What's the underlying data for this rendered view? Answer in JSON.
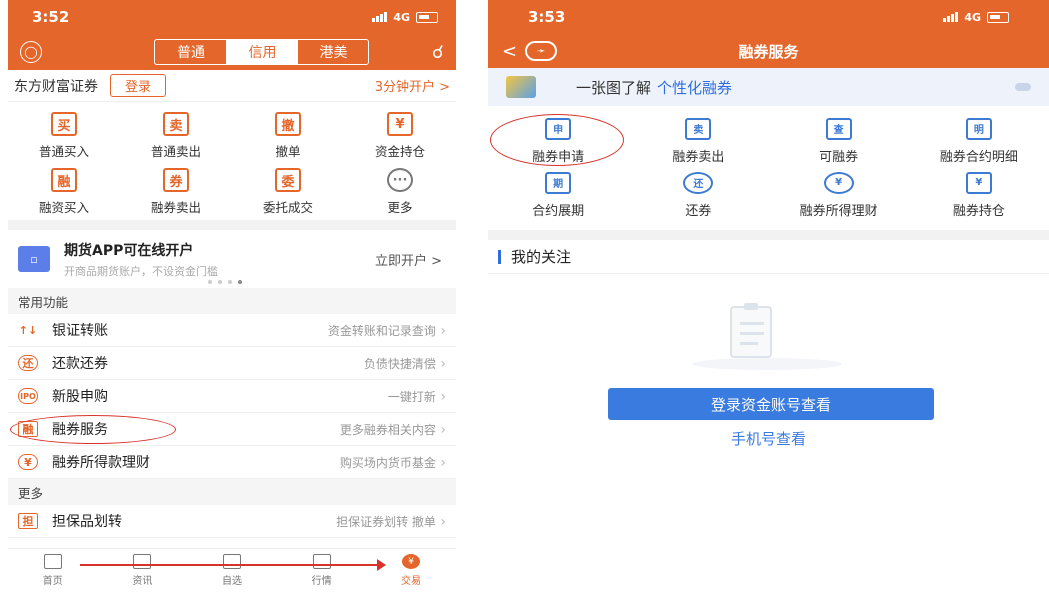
{
  "left": {
    "status": {
      "time": "3:52",
      "network": "4G"
    },
    "nav": {
      "segments": [
        "普通",
        "信用",
        "港美"
      ],
      "active_segment": 1
    },
    "broker": {
      "name": "东方财富证券",
      "login": "登录",
      "open_account": "3分钟开户 >"
    },
    "grid": [
      {
        "icon": "买",
        "label": "普通买入"
      },
      {
        "icon": "卖",
        "label": "普通卖出"
      },
      {
        "icon": "撤",
        "label": "撤单"
      },
      {
        "icon": "¥",
        "label": "资金持仓"
      },
      {
        "icon": "融",
        "label": "融资买入"
      },
      {
        "icon": "券",
        "label": "融券卖出"
      },
      {
        "icon": "委",
        "label": "委托成交"
      },
      {
        "icon": "···",
        "label": "更多"
      }
    ],
    "promo": {
      "title": "期货APP可在线开户",
      "subtitle": "开商品期货账户，不设资金门槛",
      "action": "立即开户 >"
    },
    "section_common": "常用功能",
    "rows_common": [
      {
        "icon": "↑↓",
        "label": "银证转账",
        "sub": "资金转账和记录查询"
      },
      {
        "icon": "还",
        "label": "还款还券",
        "sub": "负债快捷清偿"
      },
      {
        "icon": "IPO",
        "label": "新股申购",
        "sub": "一键打新"
      },
      {
        "icon": "融",
        "label": "融券服务",
        "sub": "更多融券相关内容"
      },
      {
        "icon": "¥",
        "label": "融券所得款理财",
        "sub": "购买场内货币基金"
      }
    ],
    "section_more": "更多",
    "rows_more": [
      {
        "icon": "担",
        "label": "担保品划转",
        "sub": "担保证券划转 撤单"
      }
    ],
    "tabs": [
      {
        "label": "首页"
      },
      {
        "label": "资讯"
      },
      {
        "label": "自选"
      },
      {
        "label": "行情"
      },
      {
        "label": "交易",
        "icon": "¥"
      }
    ]
  },
  "right": {
    "status": {
      "time": "3:53",
      "network": "4G"
    },
    "title": "融券服务",
    "banner": {
      "prefix": "一张图了解",
      "highlight": "个性化融券"
    },
    "grid": [
      {
        "icon": "申",
        "label": "融券申请"
      },
      {
        "icon": "卖",
        "label": "融券卖出"
      },
      {
        "icon": "查",
        "label": "可融券"
      },
      {
        "icon": "明",
        "label": "融券合约明细"
      },
      {
        "icon": "期",
        "label": "合约展期"
      },
      {
        "icon": "还",
        "label": "还券"
      },
      {
        "icon": "¥",
        "label": "融券所得理财"
      },
      {
        "icon": "¥",
        "label": "融券持仓"
      }
    ],
    "follow_title": "我的关注",
    "login_button": "登录资金账号查看",
    "phone_link": "手机号查看"
  },
  "colors": {
    "brand": "#e5662a",
    "accent_blue": "#3a7be0",
    "annotation_red": "#d8322a"
  }
}
